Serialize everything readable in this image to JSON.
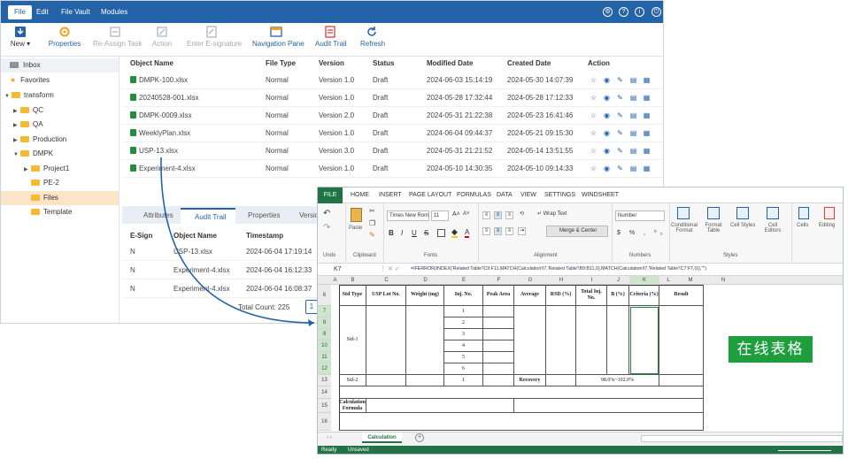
{
  "menubar": {
    "items": [
      "File",
      "Edit",
      "File Vault",
      "Modules"
    ],
    "active": "File"
  },
  "toolbar": {
    "new": "New",
    "properties": "Properties",
    "reassign": "Re-Assign Task",
    "action": "Action",
    "esign": "Enter E-signature",
    "nav": "Navigation Pane",
    "audit": "Audit Trail",
    "refresh": "Refresh"
  },
  "tree": {
    "inbox": "Inbox",
    "favorites": "Favorites",
    "transform": "transform",
    "qc": "QC",
    "qa": "QA",
    "production": "Production",
    "dmpk": "DMPK",
    "project1": "Project1",
    "pe2": "PE-2",
    "files": "Files",
    "template": "Template"
  },
  "grid": {
    "headers": [
      "Object Name",
      "File Type",
      "Version",
      "Status",
      "Modified Date",
      "Created Date",
      "Action"
    ],
    "rows": [
      [
        "DMPK-100.xlsx",
        "Normal",
        "Version 1.0",
        "Draft",
        "2024-06-03 15:14:19",
        "2024-05-30 14:07:39"
      ],
      [
        "20240528-001.xlsx",
        "Normal",
        "Version 1.0",
        "Draft",
        "2024-05-28 17:32:44",
        "2024-05-28 17:12:33"
      ],
      [
        "DMPK-0009.xlsx",
        "Normal",
        "Version 2.0",
        "Draft",
        "2024-05-31 21:22:38",
        "2024-05-23 16:41:46"
      ],
      [
        "WeeklyPlan.xlsx",
        "Normal",
        "Version 1.0",
        "Draft",
        "2024-06-04 09:44:37",
        "2024-05-21 09:15:30"
      ],
      [
        "USP-13.xlsx",
        "Normal",
        "Version 3.0",
        "Draft",
        "2024-05-31 21:21:52",
        "2024-05-14 13:51:55"
      ],
      [
        "Experiment-4.xlsx",
        "Normal",
        "Version 1.0",
        "Draft",
        "2024-05-10 14:30:35",
        "2024-05-10 09:14:33"
      ]
    ]
  },
  "bottom": {
    "tabs": [
      "Attributes",
      "Audit Trail",
      "Properties",
      "Version"
    ],
    "headers": [
      "E-Sign",
      "Object Name",
      "Timestamp"
    ],
    "rows": [
      [
        "N",
        "USP-13.xlsx",
        "2024-06-04 17:19:14"
      ],
      [
        "N",
        "Experiment-4.xlsx",
        "2024-06-04 16:12:33"
      ],
      [
        "N",
        "Experiment-4.xlsx",
        "2024-06-04 16:08:37"
      ]
    ],
    "total": "Total Count: 225",
    "page": "1"
  },
  "excel": {
    "menu": [
      "FILE",
      "HOME",
      "INSERT",
      "PAGE LAYOUT",
      "FORMULAS",
      "DATA",
      "VIEW",
      "SETTINGS",
      "WINDSHEET"
    ],
    "ribbon": {
      "undo": "Undo",
      "paste": "Paste",
      "clipboard": "Clipboard",
      "font_name": "Times New Roma",
      "font_size": "11",
      "fonts": "Fonts",
      "wrap": "Wrap Text",
      "merge": "Merge & Center",
      "alignment": "Alignment",
      "numfmt": "Number",
      "numbers": "Numbers",
      "cond": "Conditional\nFormat",
      "fmt_table": "Format\nTable",
      "cell_styles": "Cell Styles",
      "cell_editors": "Cell\nEditors",
      "styles": "Styles",
      "cells": "Cells",
      "editing": "Editing"
    },
    "namebox": "K7",
    "formula": "=IFERROR(INDEX('Related Table'!C9:F11,MATCH(Calculation!I7,'Related Table'!B9:B11,0),MATCH(Calculation!I7,'Related Table'!C7:F7,0)),\"\")",
    "cols": [
      "A",
      "B",
      "C",
      "D",
      "E",
      "F",
      "G",
      "H",
      "I",
      "J",
      "K",
      "L",
      "M",
      "N"
    ],
    "rows": [
      "6",
      "7",
      "8",
      "9",
      "10",
      "11",
      "12",
      "13",
      "14",
      "15",
      "16"
    ],
    "headers": [
      "Std Type",
      "USP Lot No.",
      "Weight (mg)",
      "Inj. No.",
      "Peak Area",
      "Average",
      "RSD (%)",
      "Total Inj. No.",
      "B (%)",
      "Criteria (%)",
      "Result"
    ],
    "std1": "Std-1",
    "inj": [
      "1",
      "2",
      "3",
      "4",
      "5",
      "6"
    ],
    "std2": "Std-2",
    "inj2": "1",
    "recovery": "Recovery",
    "range": "98.0%~102.0%",
    "calc": "Calculation Formula",
    "sheet_tab": "Calculation",
    "status_ready": "Ready",
    "status_unsaved": "Unsaved"
  },
  "badge": "在线表格",
  "colors": {
    "brand": "#2463a8",
    "excel": "#217346",
    "badge": "#1f9e3e",
    "selection": "#fde4c8"
  }
}
